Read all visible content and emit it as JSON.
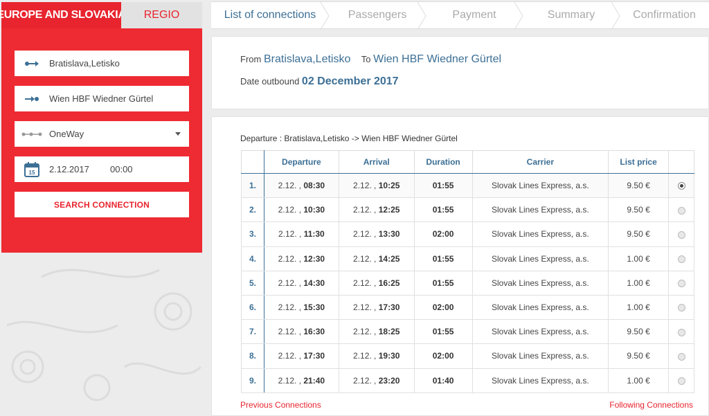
{
  "tabs": {
    "europe": "EUROPE AND SLOVAKIA",
    "regio": "REGIO"
  },
  "search": {
    "from": "Bratislava,Letisko",
    "to": "Wien HBF Wiedner Gürtel",
    "trip_type": "OneWay",
    "date": "2.12.2017",
    "time": "00:00",
    "calendar_day": "15",
    "button": "SEARCH CONNECTION"
  },
  "steps": [
    "List of connections",
    "Passengers",
    "Payment",
    "Summary",
    "Confirmation"
  ],
  "route": {
    "from_label": "From",
    "from_value": "Bratislava,Letisko",
    "to_label": "To",
    "to_value": "Wien HBF Wiedner Gürtel",
    "date_label": "Date outbound",
    "date_value": "02 December 2017"
  },
  "connections": {
    "title": "Departure : Bratislava,Letisko -> Wien HBF Wiedner Gürtel",
    "headers": [
      "",
      "Departure",
      "Arrival",
      "Duration",
      "Carrier",
      "List price",
      ""
    ],
    "rows": [
      {
        "n": "1.",
        "dep_d": "2.12. ,",
        "dep_t": "08:30",
        "arr_d": "2.12. ,",
        "arr_t": "10:25",
        "dur": "01:55",
        "carrier": "Slovak Lines Express, a.s.",
        "price": "9.50 €"
      },
      {
        "n": "2.",
        "dep_d": "2.12. ,",
        "dep_t": "10:30",
        "arr_d": "2.12. ,",
        "arr_t": "12:25",
        "dur": "01:55",
        "carrier": "Slovak Lines Express, a.s.",
        "price": "9.50 €"
      },
      {
        "n": "3.",
        "dep_d": "2.12. ,",
        "dep_t": "11:30",
        "arr_d": "2.12. ,",
        "arr_t": "13:30",
        "dur": "02:00",
        "carrier": "Slovak Lines Express, a.s.",
        "price": "9.50 €"
      },
      {
        "n": "4.",
        "dep_d": "2.12. ,",
        "dep_t": "12:30",
        "arr_d": "2.12. ,",
        "arr_t": "14:25",
        "dur": "01:55",
        "carrier": "Slovak Lines Express, a.s.",
        "price": "1.00 €"
      },
      {
        "n": "5.",
        "dep_d": "2.12. ,",
        "dep_t": "14:30",
        "arr_d": "2.12. ,",
        "arr_t": "16:25",
        "dur": "01:55",
        "carrier": "Slovak Lines Express, a.s.",
        "price": "1.00 €"
      },
      {
        "n": "6.",
        "dep_d": "2.12. ,",
        "dep_t": "15:30",
        "arr_d": "2.12. ,",
        "arr_t": "17:30",
        "dur": "02:00",
        "carrier": "Slovak Lines Express, a.s.",
        "price": "1.00 €"
      },
      {
        "n": "7.",
        "dep_d": "2.12. ,",
        "dep_t": "16:30",
        "arr_d": "2.12. ,",
        "arr_t": "18:25",
        "dur": "01:55",
        "carrier": "Slovak Lines Express, a.s.",
        "price": "9.50 €"
      },
      {
        "n": "8.",
        "dep_d": "2.12. ,",
        "dep_t": "17:30",
        "arr_d": "2.12. ,",
        "arr_t": "19:30",
        "dur": "02:00",
        "carrier": "Slovak Lines Express, a.s.",
        "price": "9.50 €"
      },
      {
        "n": "9.",
        "dep_d": "2.12. ,",
        "dep_t": "21:40",
        "arr_d": "2.12. ,",
        "arr_t": "23:20",
        "dur": "01:40",
        "carrier": "Slovak Lines Express, a.s.",
        "price": "1.00 €"
      }
    ],
    "selected_index": 0,
    "prev": "Previous Connections",
    "next": "Following Connections"
  },
  "colors": {
    "brand_red": "#ee2a32",
    "accent_blue": "#3c6f95"
  }
}
